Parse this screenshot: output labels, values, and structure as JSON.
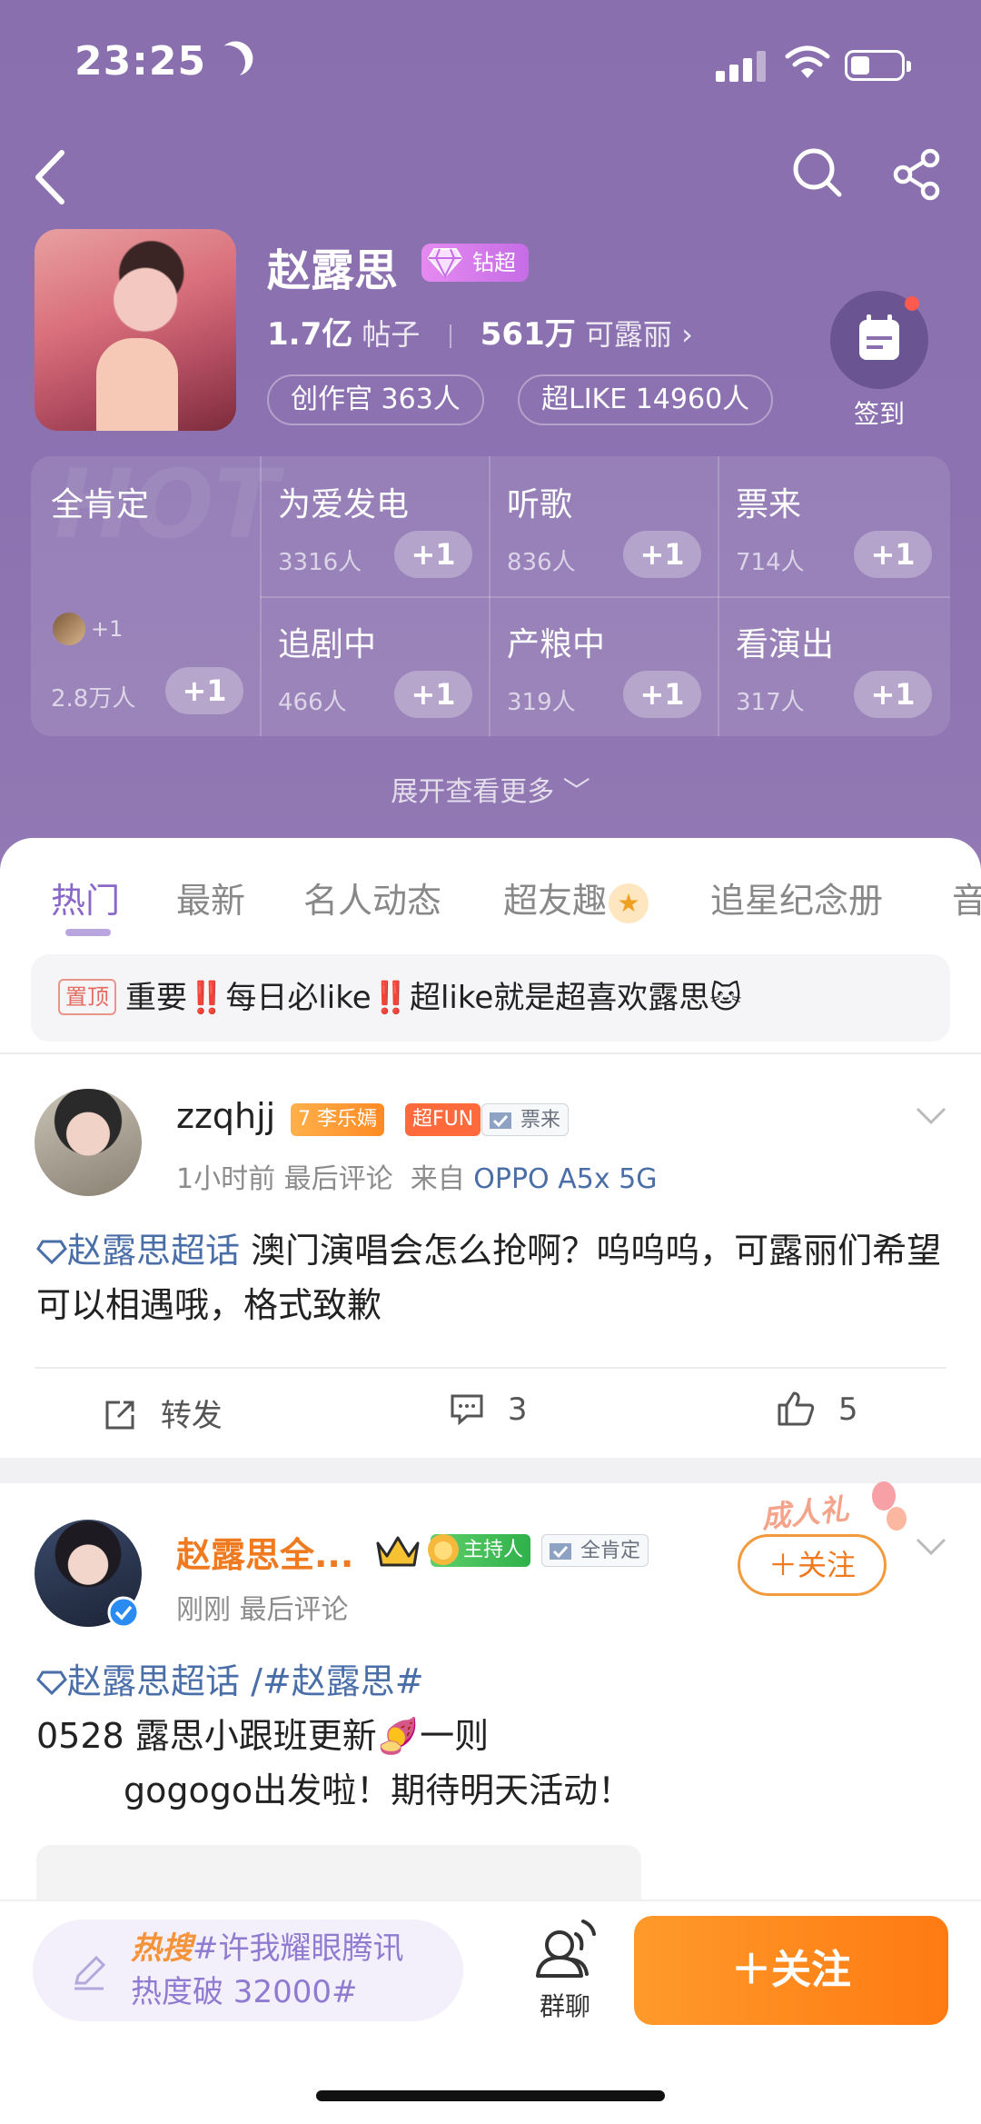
{
  "status_bar": {
    "time": "23:25",
    "battery_level": 0.35
  },
  "topic": {
    "name": "赵露思",
    "badge": "钻超",
    "posts_count": "1.7亿",
    "posts_label": "帖子",
    "fans_count": "561万",
    "fans_label": "可露丽",
    "fans_chevron": "›",
    "pills": [
      "创作官 363人",
      "超LIKE 14960人"
    ],
    "checkin_label": "签到"
  },
  "tags_grid": {
    "watermark": "HOT",
    "first": {
      "label": "全肯定",
      "count": "2.8万人",
      "mini_plus": "+1",
      "plus": "+1"
    },
    "items": [
      {
        "label": "为爱发电",
        "count": "3316人",
        "plus": "+1"
      },
      {
        "label": "听歌",
        "count": "836人",
        "plus": "+1"
      },
      {
        "label": "票来",
        "count": "714人",
        "plus": "+1"
      },
      {
        "label": "追剧中",
        "count": "466人",
        "plus": "+1"
      },
      {
        "label": "产粮中",
        "count": "319人",
        "plus": "+1"
      },
      {
        "label": "看演出",
        "count": "317人",
        "plus": "+1"
      }
    ],
    "expand_label": "展开查看更多 ﹀"
  },
  "tabs": [
    "热门",
    "最新",
    "名人动态",
    "超友趣",
    "追星纪念册",
    "音"
  ],
  "tabs_star": "★",
  "pinned": {
    "tag": "置顶",
    "text_before": "重要",
    "excl": "‼️",
    "text_mid": "每日必like",
    "text_after": "超like就是超喜欢露思🐱"
  },
  "posts": [
    {
      "user": "zzqhjj",
      "chips": [
        "7 李乐嫣",
        "超FUN",
        "票来"
      ],
      "meta_time": "1小时前",
      "meta_comment": "最后评论",
      "meta_from": "来自",
      "device": "OPPO A5x 5G",
      "topic_link": "赵露思超话",
      "text": "澳门演唱会怎么抢啊？呜呜呜，可露丽们希望可以相遇哦，格式致歉",
      "actions": {
        "repost": "转发",
        "comments": "3",
        "likes": "5"
      }
    },
    {
      "user": "赵露思全...",
      "chips": [
        "主持人",
        "全肯定"
      ],
      "meta_time": "刚刚",
      "meta_comment": "最后评论",
      "adult_tag": "成人礼",
      "follow": "＋关注",
      "topic_link": "赵露思超话",
      "hashtag": "/#赵露思#",
      "line1": "0528 露思小跟班更新🍠一则",
      "line2": "gogogo出发啦！期待明天活动！"
    }
  ],
  "bottom": {
    "hot_search_prefix": "热搜",
    "hot_search_text": "#许我耀眼腾讯热度破 32000#",
    "group_chat": "群聊",
    "follow": "＋关注"
  },
  "colors": {
    "hero": "#8a6fae",
    "accent_orange": "#ff8a1e",
    "link_blue": "#4a6ea8",
    "tab_active": "#8a68c8"
  }
}
